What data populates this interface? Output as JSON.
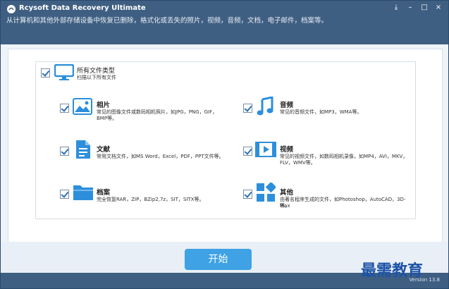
{
  "app": {
    "title": "Rcysoft Data Recovery Ultimate",
    "subtitle": "从计算机和其他外部存储设备中恢复已删除，格式化或丢失的照片，视频，音频，文档，电子邮件，档案等。",
    "version": "Version 13.8",
    "window_controls": [
      "⤓",
      "–",
      "□",
      "×"
    ]
  },
  "all_types": {
    "label": "所有文件类型",
    "desc": "扫描以下所有文件",
    "checked": true
  },
  "categories": [
    {
      "title": "相片",
      "desc_line1": "常见的图像文件或数码相机照片，如JPG，PNG，GIF，",
      "desc_line2": "BMP等。",
      "icon": "image-icon",
      "checked": true
    },
    {
      "title": "音频",
      "desc_line1": "常见的音频文件，如MP3，WMA等。",
      "desc_line2": "",
      "icon": "music-icon",
      "checked": true
    },
    {
      "title": "文献",
      "desc_line1": "常用文档文件，如MS Word，Excel，PDF，PPT文件等。",
      "desc_line2": "",
      "icon": "document-icon",
      "checked": true
    },
    {
      "title": "视频",
      "desc_line1": "常见的视频文件，如数码相机录像，如MP4，AVI，MKV，",
      "desc_line2": "FLV，WMV等。",
      "icon": "video-icon",
      "checked": true
    },
    {
      "title": "档案",
      "desc_line1": "完全恢复RAR，ZIP，BZip2,7z，SIT，SITX等。",
      "desc_line2": "",
      "icon": "folder-icon",
      "checked": true
    },
    {
      "title": "其他",
      "desc_line1": "由著名程序生成的文件，如Photoshop，AutoCAD，3D-Max",
      "desc_line2": "等。",
      "icon": "apps-icon",
      "checked": true
    }
  ],
  "start_button": "开始",
  "watermark": "最需教育",
  "colors": {
    "titlebar": "#3f5f82",
    "accent": "#3ea2e4",
    "icon": "#2d8fdc"
  }
}
